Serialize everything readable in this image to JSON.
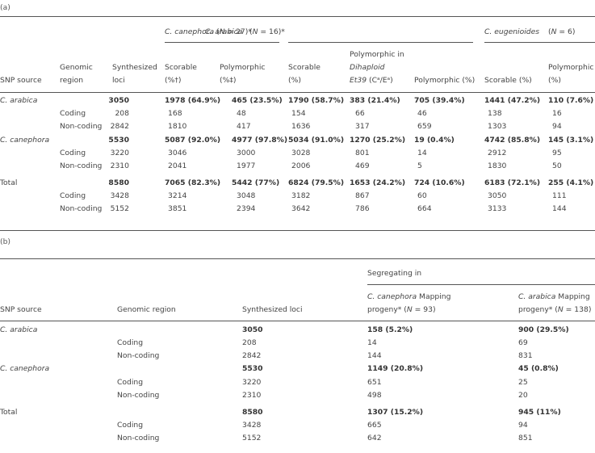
{
  "table_a": {
    "label": "(a)",
    "groups": {
      "canephora": {
        "species": "C. canephora",
        "n": "(N = 27)*"
      },
      "arabica": {
        "species": "C. arabica",
        "n": "(N = 16)*"
      },
      "eugenioides": {
        "species": "C. eugenioides",
        "n": "(N = 6)"
      }
    },
    "headers": {
      "snp_source": "SNP source",
      "genomic_region_1": "Genomic",
      "genomic_region_2": "region",
      "synth_1": "Synthesized",
      "synth_2": "loci",
      "cc_scorable_1": "Scorable",
      "cc_scorable_2": "(%†)",
      "cc_poly_1": "Polymorphic",
      "cc_poly_2": "(%‡)",
      "ca_scorable_1": "Scorable",
      "ca_scorable_2": "(%)",
      "ca_dihap_1": "Polymorphic in",
      "ca_dihap_2": "Dihaploid",
      "ca_dihap_3a": "Et39",
      "ca_dihap_3b": " (Cᵃ/Eᵃ)",
      "ca_poly": "Polymorphic (%)",
      "ce_scorable": "Scorable (%)",
      "ce_poly_1": "Polymorphic",
      "ce_poly_2": "(%)"
    },
    "rows": [
      {
        "source": "C. arabica",
        "region": "",
        "synth": "3050",
        "cc_scor": "1978 (64.9%)",
        "cc_poly": "465 (23.5%)",
        "ca_scor": "1790 (58.7%)",
        "ca_dihap": "383 (21.4%)",
        "ca_poly": "705 (39.4%)",
        "ce_scor": "1441 (47.2%)",
        "ce_poly": "110 (7.6%)",
        "bold": true,
        "italic_source": true
      },
      {
        "source": "",
        "region": "Coding",
        "synth": "208",
        "cc_scor": "168",
        "cc_poly": "48",
        "ca_scor": "154",
        "ca_dihap": "66",
        "ca_poly": "46",
        "ce_scor": "138",
        "ce_poly": "16"
      },
      {
        "source": "",
        "region": "Non-coding",
        "synth": "2842",
        "cc_scor": "1810",
        "cc_poly": "417",
        "ca_scor": "1636",
        "ca_dihap": "317",
        "ca_poly": "659",
        "ce_scor": "1303",
        "ce_poly": "94"
      },
      {
        "source": "C. canephora",
        "region": "",
        "synth": "5530",
        "cc_scor": "5087 (92.0%)",
        "cc_poly": "4977 (97.8%)",
        "ca_scor": "5034 (91.0%)",
        "ca_dihap": "1270 (25.2%)",
        "ca_poly": "19 (0.4%)",
        "ce_scor": "4742 (85.8%)",
        "ce_poly": "145 (3.1%)",
        "bold": true,
        "italic_source": true
      },
      {
        "source": "",
        "region": "Coding",
        "synth": "3220",
        "cc_scor": "3046",
        "cc_poly": "3000",
        "ca_scor": "3028",
        "ca_dihap": "801",
        "ca_poly": "14",
        "ce_scor": "2912",
        "ce_poly": "95"
      },
      {
        "source": "",
        "region": "Non-coding",
        "synth": "2310",
        "cc_scor": "2041",
        "cc_poly": "1977",
        "ca_scor": "2006",
        "ca_dihap": "469",
        "ca_poly": "5",
        "ce_scor": "1830",
        "ce_poly": "50"
      },
      {
        "source": "Total",
        "region": "",
        "synth": "8580",
        "cc_scor": "7065 (82.3%)",
        "cc_poly": "5442 (77%)",
        "ca_scor": "6824 (79.5%)",
        "ca_dihap": "1653 (24.2%)",
        "ca_poly": "724 (10.6%)",
        "ce_scor": "6183 (72.1%)",
        "ce_poly": "255 (4.1%)",
        "bold": true
      },
      {
        "source": "",
        "region": "Coding",
        "synth": "3428",
        "cc_scor": "3214",
        "cc_poly": "3048",
        "ca_scor": "3182",
        "ca_dihap": "867",
        "ca_poly": "60",
        "ce_scor": "3050",
        "ce_poly": "111"
      },
      {
        "source": "",
        "region": "Non-coding",
        "synth": "5152",
        "cc_scor": "3851",
        "cc_poly": "2394",
        "ca_scor": "3642",
        "ca_dihap": "786",
        "ca_poly": "664",
        "ce_scor": "3133",
        "ce_poly": "144"
      }
    ]
  },
  "table_b": {
    "label": "(b)",
    "headers": {
      "snp_source": "SNP source",
      "genomic_region": "Genomic region",
      "synth": "Synthesized loci",
      "segregating": "Segregating in",
      "cc_species": "C. canephora",
      "cc_rest_1": " Mapping",
      "cc_2a": "progeny* (",
      "cc_2n": "N",
      "cc_2b": " = 93)",
      "ca_species": "C. arabica",
      "ca_rest_1": " Mapping",
      "ca_2a": "progeny* (",
      "ca_2n": "N",
      "ca_2b": " = 138)"
    },
    "rows": [
      {
        "source": "C. arabica",
        "region": "",
        "synth": "3050",
        "cc": "158 (5.2%)",
        "ca": "900 (29.5%)",
        "bold": true,
        "italic_source": true
      },
      {
        "source": "",
        "region": "Coding",
        "synth": "208",
        "cc": "14",
        "ca": "69"
      },
      {
        "source": "",
        "region": "Non-coding",
        "synth": "2842",
        "cc": "144",
        "ca": "831"
      },
      {
        "source": "C. canephora",
        "region": "",
        "synth": "5530",
        "cc": "1149 (20.8%)",
        "ca": "45 (0.8%)",
        "bold": true,
        "italic_source": true
      },
      {
        "source": "",
        "region": "Coding",
        "synth": "3220",
        "cc": "651",
        "ca": "25"
      },
      {
        "source": "",
        "region": "Non-coding",
        "synth": "2310",
        "cc": "498",
        "ca": "20"
      },
      {
        "source": "Total",
        "region": "",
        "synth": "8580",
        "cc": "1307 (15.2%)",
        "ca": "945 (11%)",
        "bold": true
      },
      {
        "source": "",
        "region": "Coding",
        "synth": "3428",
        "cc": "665",
        "ca": "94"
      },
      {
        "source": "",
        "region": "Non-coding",
        "synth": "5152",
        "cc": "642",
        "ca": "851"
      }
    ]
  }
}
